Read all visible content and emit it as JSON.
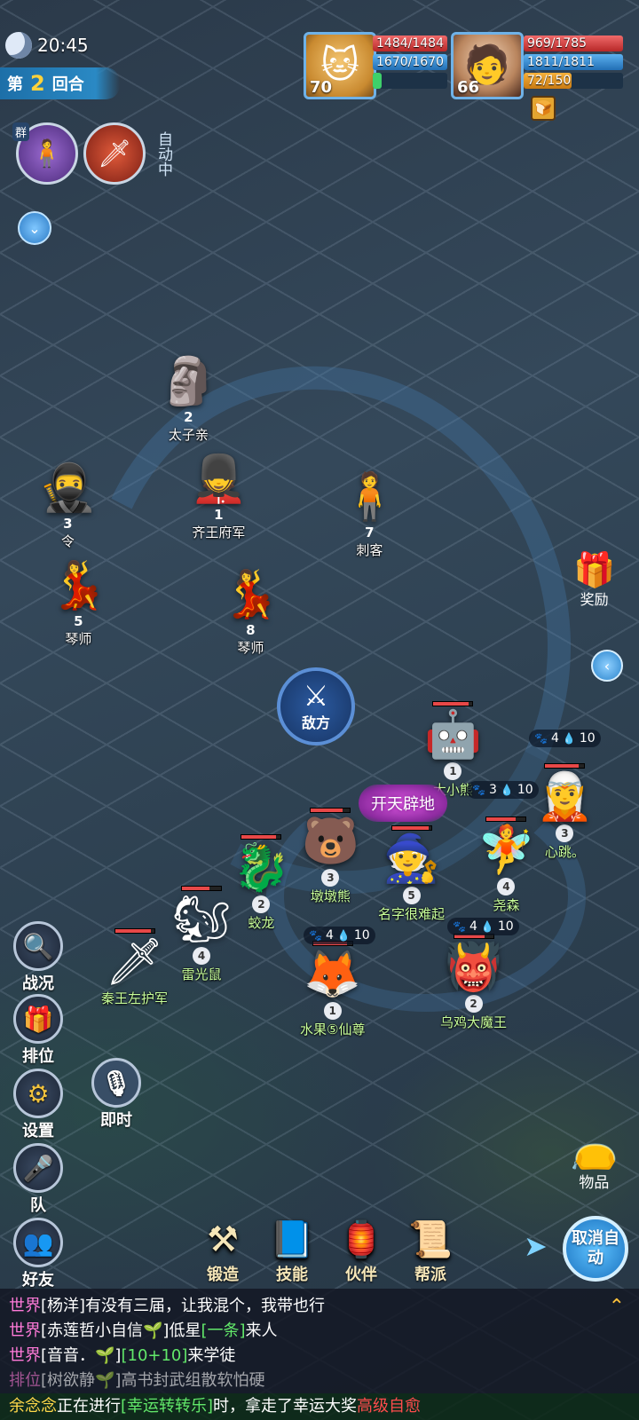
{
  "status": {
    "time": "20:45"
  },
  "round": {
    "prefix": "第",
    "number": "2",
    "suffix": "回合"
  },
  "skills": {
    "group_tag": "群",
    "auto_label": "自动中"
  },
  "pet": {
    "level": "70",
    "hp": "1484/1484",
    "mp": "1670/1670",
    "sp_fraction": 0.12
  },
  "hero": {
    "level": "66",
    "hp": "969/1785",
    "mp": "1811/1811",
    "sp": "72/150",
    "sp_fraction": 0.48
  },
  "enemies": [
    {
      "id": "enemy-2",
      "num": "2",
      "name": "太子亲"
    },
    {
      "id": "enemy-3",
      "num": "3",
      "name": "令"
    },
    {
      "id": "enemy-1",
      "num": "1",
      "name": "齐王府军"
    },
    {
      "id": "enemy-7",
      "num": "7",
      "name": "刺客"
    },
    {
      "id": "enemy-5",
      "num": "5",
      "name": "琴师"
    },
    {
      "id": "enemy-8",
      "num": "8",
      "name": "琴师"
    }
  ],
  "enemy_target_label": "敌方",
  "skill_float": "开天辟地",
  "allies": [
    {
      "id": "ally-1",
      "num": "1",
      "name": "大小熊"
    },
    {
      "id": "ally-3a",
      "num": "3",
      "name": "心跳。"
    },
    {
      "id": "ally-3b",
      "num": "3",
      "name": "墩墩熊"
    },
    {
      "id": "ally-5",
      "num": "5",
      "name": "名字很难起"
    },
    {
      "id": "ally-4a",
      "num": "4",
      "name": "尧森"
    },
    {
      "id": "ally-2a",
      "num": "2",
      "name": "蛟龙"
    },
    {
      "id": "ally-4b",
      "num": "4",
      "name": "雷光鼠"
    },
    {
      "id": "ally-p",
      "num": "",
      "name": "秦王左护军"
    },
    {
      "id": "ally-1b",
      "num": "1",
      "name": "水果⑤仙尊"
    },
    {
      "id": "ally-2b",
      "num": "2",
      "name": "乌鸡大魔王"
    }
  ],
  "chips": [
    {
      "paw": "4",
      "drop": "10"
    },
    {
      "paw": "3",
      "drop": "10"
    },
    {
      "paw": "4",
      "drop": "10"
    },
    {
      "paw": "4",
      "drop": "10"
    }
  ],
  "side": {
    "reward": "奖励",
    "items": "物品"
  },
  "left_buttons": {
    "battle": "战况",
    "rank": "排位",
    "settings": "设置",
    "team": "队",
    "friends": "好友",
    "voice": "即时"
  },
  "bottom_menu": [
    "锻造",
    "技能",
    "伙伴",
    "帮派"
  ],
  "cancel_auto": "取消自动",
  "chat": [
    {
      "channel": "世界",
      "text": "[杨洋]有没有三届，让我混个，我带也行"
    },
    {
      "channel": "世界",
      "text": "[赤莲哲小自信🌱]低星",
      "hl": "[一条]",
      "tail": "来人"
    },
    {
      "channel": "世界",
      "text": "[音音．🌱]",
      "hl": "[10+10]",
      "tail": "来学徒"
    },
    {
      "channel": "排位",
      "text": "[树欲静🌱]高书封武组散软怕硬"
    }
  ],
  "marquee": {
    "name": "余念念",
    "mid": "正在进行",
    "act": "[幸运转转乐]",
    "mid2": "时，拿走了幸运大奖",
    "big": "高级自愈"
  }
}
